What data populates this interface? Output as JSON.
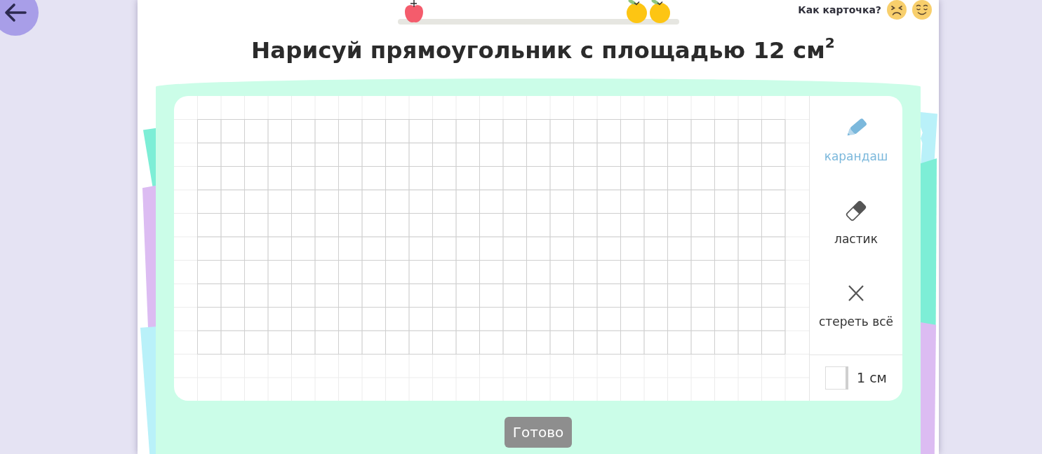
{
  "feedback": {
    "question": "Как карточка?"
  },
  "task": {
    "title": "Нарисуй прямоугольник с площадью 12 см$^{2}$"
  },
  "tools": [
    {
      "kind": "pencil",
      "label": "карандаш",
      "selected": true
    },
    {
      "kind": "eraser",
      "label": "ластик",
      "selected": false
    },
    {
      "kind": "clear",
      "label": "стереть всё",
      "selected": false
    }
  ],
  "scale": {
    "label": "1 см"
  },
  "done_button": {
    "label": "Готово",
    "disabled": true
  }
}
